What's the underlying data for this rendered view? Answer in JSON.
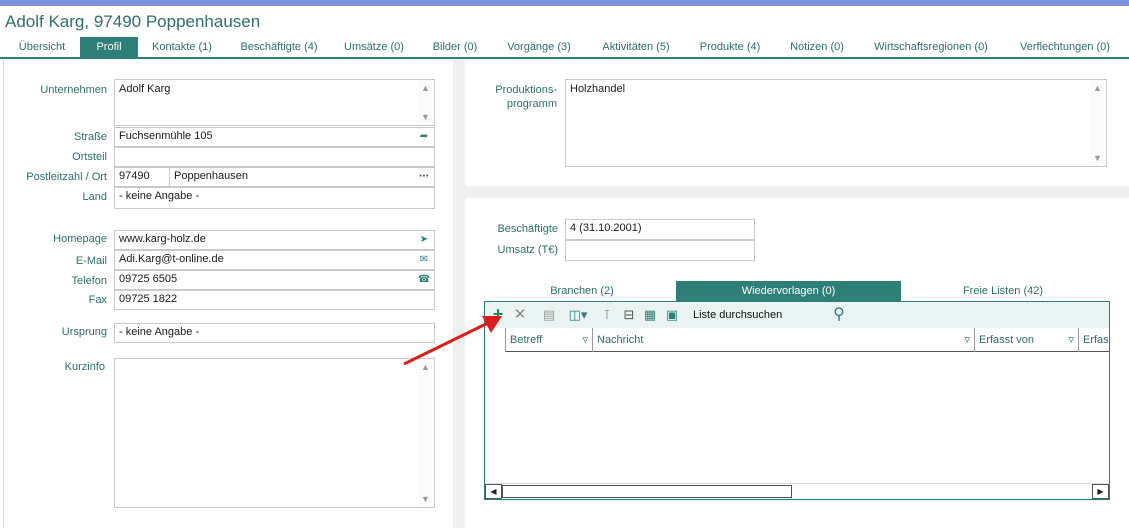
{
  "title": "Adolf Karg, 97490 Poppenhausen",
  "tabs": [
    {
      "label": "Übersicht"
    },
    {
      "label": "Profil"
    },
    {
      "label": "Kontakte (1)"
    },
    {
      "label": "Beschäftigte (4)"
    },
    {
      "label": "Umsätze (0)"
    },
    {
      "label": "Bilder (0)"
    },
    {
      "label": "Vorgänge (3)"
    },
    {
      "label": "Aktivitäten (5)"
    },
    {
      "label": "Produkte (4)"
    },
    {
      "label": "Notizen (0)"
    },
    {
      "label": "Wirtschaftsregionen (0)"
    },
    {
      "label": "Verflechtungen (0)"
    }
  ],
  "active_tab": "Profil",
  "left": {
    "unternehmen": {
      "label": "Unternehmen",
      "value": "Adolf Karg"
    },
    "strasse": {
      "label": "Straße",
      "value": "Fuchsenmühle 105"
    },
    "ortsteil": {
      "label": "Ortsteil",
      "value": ""
    },
    "plz_ort": {
      "label": "Postleitzahl / Ort",
      "plz": "97490",
      "ort": "Poppenhausen"
    },
    "land": {
      "label": "Land",
      "value": "- keine Angabe -"
    },
    "homepage": {
      "label": "Homepage",
      "value": "www.karg-holz.de"
    },
    "email": {
      "label": "E-Mail",
      "value": "Adi.Karg@t-online.de"
    },
    "telefon": {
      "label": "Telefon",
      "value": "09725 6505"
    },
    "fax": {
      "label": "Fax",
      "value": "09725 1822"
    },
    "ursprung": {
      "label": "Ursprung",
      "value": "- keine Angabe -"
    },
    "kurzinfo": {
      "label": "Kurzinfo",
      "value": ""
    }
  },
  "right": {
    "produktionsprogramm": {
      "label_1": "Produktions-",
      "label_2": "programm",
      "value": "Holzhandel"
    },
    "beschaeftigte": {
      "label": "Beschäftigte",
      "value": "4  (31.10.2001)"
    },
    "umsatz": {
      "label": "Umsatz (T€)",
      "value": ""
    },
    "subtabs": [
      {
        "label": "Branchen (2)"
      },
      {
        "label": "Wiedervorlagen (0)"
      },
      {
        "label": "Freie Listen (42)"
      }
    ],
    "active_subtab": "Wiedervorlagen (0)",
    "search_label": "Liste durchsuchen",
    "columns": [
      {
        "label": "Betreff"
      },
      {
        "label": "Nachricht"
      },
      {
        "label": "Erfasst von"
      },
      {
        "label": "Erfass"
      }
    ]
  },
  "colors": {
    "accent": "#2f7f79",
    "add_icon": "#1f8a5a",
    "annotation_arrow": "#e01b1b",
    "window_top": "#7c93d9"
  }
}
